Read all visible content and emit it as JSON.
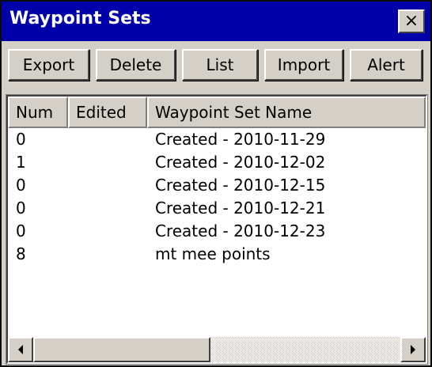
{
  "window": {
    "title": "Waypoint Sets",
    "close_label": "×"
  },
  "toolbar": {
    "buttons": [
      {
        "label": "Export"
      },
      {
        "label": "Delete"
      },
      {
        "label": "List"
      },
      {
        "label": "Import"
      },
      {
        "label": "Alert"
      }
    ]
  },
  "table": {
    "columns": [
      {
        "label": "Num"
      },
      {
        "label": "Edited"
      },
      {
        "label": "Waypoint Set Name"
      }
    ],
    "rows": [
      {
        "num": "0",
        "edited": "",
        "name": "Created - 2010-11-29"
      },
      {
        "num": "1",
        "edited": "",
        "name": "Created - 2010-12-02"
      },
      {
        "num": "0",
        "edited": "",
        "name": "Created - 2010-12-15"
      },
      {
        "num": "0",
        "edited": "",
        "name": "Created - 2010-12-21"
      },
      {
        "num": "0",
        "edited": "",
        "name": "Created - 2010-12-23"
      },
      {
        "num": "8",
        "edited": "",
        "name": "mt mee points"
      }
    ]
  },
  "scrollbar": {
    "left_icon": "left-arrow-icon",
    "right_icon": "right-arrow-icon"
  },
  "colors": {
    "titlebar": "#0000a8",
    "face": "#d4d0c8",
    "list_bg": "#ffffff"
  }
}
